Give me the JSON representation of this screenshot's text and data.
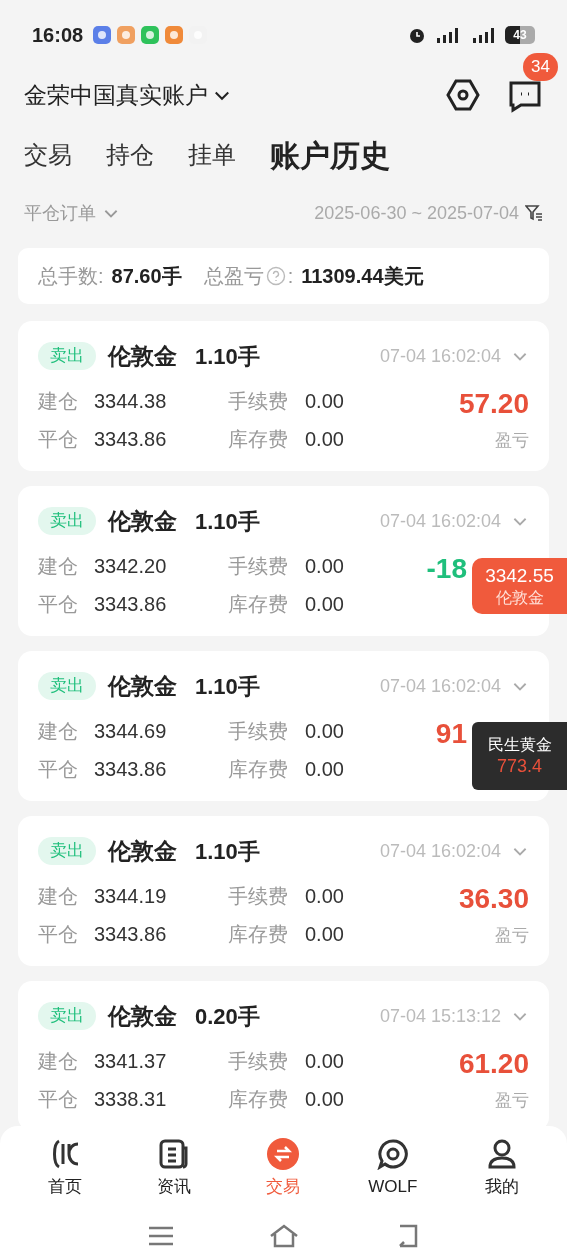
{
  "status_bar": {
    "time": "16:08",
    "battery": "43"
  },
  "header": {
    "account": "金荣中国真实账户",
    "message_badge": "34"
  },
  "tabs": [
    {
      "label": "交易",
      "selected": false
    },
    {
      "label": "持仓",
      "selected": false
    },
    {
      "label": "挂单",
      "selected": false
    },
    {
      "label": "账户历史",
      "selected": true
    }
  ],
  "filter": {
    "order_type": "平仓订单",
    "date_range": "2025-06-30 ~ 2025-07-04"
  },
  "summary": {
    "lots_label": "总手数:",
    "lots": "87.60手",
    "pnl_label": "总盈亏",
    "pnl_colon": ":",
    "pnl": "11309.44美元"
  },
  "orders": [
    {
      "side": "卖出",
      "symbol": "伦敦金",
      "lots": "1.10手",
      "time": "07-04 16:02:04",
      "open_label": "建仓",
      "open": "3344.38",
      "close_label": "平仓",
      "close": "3343.86",
      "fee_label": "手续费",
      "fee": "0.00",
      "swap_label": "库存费",
      "swap": "0.00",
      "pnl": "57.20",
      "loss": false,
      "pnl_label": "盈亏"
    },
    {
      "side": "卖出",
      "symbol": "伦敦金",
      "lots": "1.10手",
      "time": "07-04 16:02:04",
      "open_label": "建仓",
      "open": "3342.20",
      "close_label": "平仓",
      "close": "3343.86",
      "fee_label": "手续费",
      "fee": "0.00",
      "swap_label": "库存费",
      "swap": "0.00",
      "pnl": "-18",
      "loss": true,
      "covered": true
    },
    {
      "side": "卖出",
      "symbol": "伦敦金",
      "lots": "1.10手",
      "time": "07-04 16:02:04",
      "open_label": "建仓",
      "open": "3344.69",
      "close_label": "平仓",
      "close": "3343.86",
      "fee_label": "手续费",
      "fee": "0.00",
      "swap_label": "库存费",
      "swap": "0.00",
      "pnl": "91",
      "loss": false,
      "covered": true
    },
    {
      "side": "卖出",
      "symbol": "伦敦金",
      "lots": "1.10手",
      "time": "07-04 16:02:04",
      "open_label": "建仓",
      "open": "3344.19",
      "close_label": "平仓",
      "close": "3343.86",
      "fee_label": "手续费",
      "fee": "0.00",
      "swap_label": "库存费",
      "swap": "0.00",
      "pnl": "36.30",
      "loss": false,
      "pnl_label": "盈亏"
    },
    {
      "side": "卖出",
      "symbol": "伦敦金",
      "lots": "0.20手",
      "time": "07-04 15:13:12",
      "open_label": "建仓",
      "open": "3341.37",
      "close_label": "平仓",
      "close": "3338.31",
      "fee_label": "手续费",
      "fee": "0.00",
      "swap_label": "库存费",
      "swap": "0.00",
      "pnl": "61.20",
      "loss": false,
      "pnl_label": "盈亏"
    }
  ],
  "floating_quotes": [
    {
      "kind": "red",
      "price": "3342.55",
      "name": "伦敦金"
    },
    {
      "kind": "dark",
      "name": "民生黄金",
      "price": "773.4"
    }
  ],
  "bottom_nav": [
    {
      "label": "首页",
      "selected": false
    },
    {
      "label": "资讯",
      "selected": false
    },
    {
      "label": "交易",
      "selected": true
    },
    {
      "label": "WOLF",
      "selected": false
    },
    {
      "label": "我的",
      "selected": false
    }
  ]
}
